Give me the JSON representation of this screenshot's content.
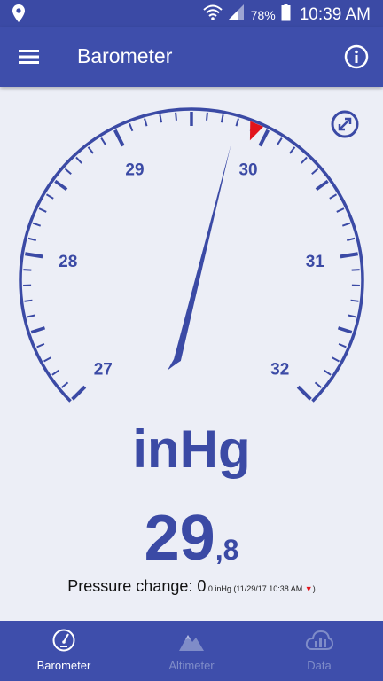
{
  "status_bar": {
    "battery_percent": "78%",
    "time": "10:39 AM",
    "icons": [
      "location-icon",
      "wifi-icon",
      "signal-icon",
      "battery-icon"
    ]
  },
  "app_bar": {
    "title": "Barometer",
    "icons": [
      "menu-icon",
      "info-icon"
    ]
  },
  "gauge": {
    "min": 27,
    "max": 32,
    "labels": [
      "27",
      "28",
      "29",
      "30",
      "31",
      "32"
    ],
    "needle_value": 29.8,
    "reference_marker_value": 29.92,
    "accent_color": "#3b4aa5",
    "marker_color": "#e2141c"
  },
  "unit": "inHg",
  "reading": {
    "integer": "29",
    "decimal": ",8"
  },
  "pressure_change": {
    "label": "Pressure change: ",
    "value": "0",
    "detail": ",0 inHg (11/29/17 10:38 AM ",
    "trend_arrow": "▼",
    "closing": ")"
  },
  "bottom_nav": {
    "items": [
      {
        "label": "Barometer",
        "icon": "gauge-icon",
        "active": true
      },
      {
        "label": "Altimeter",
        "icon": "mountain-icon",
        "active": false
      },
      {
        "label": "Data",
        "icon": "cloud-chart-icon",
        "active": false
      }
    ]
  }
}
